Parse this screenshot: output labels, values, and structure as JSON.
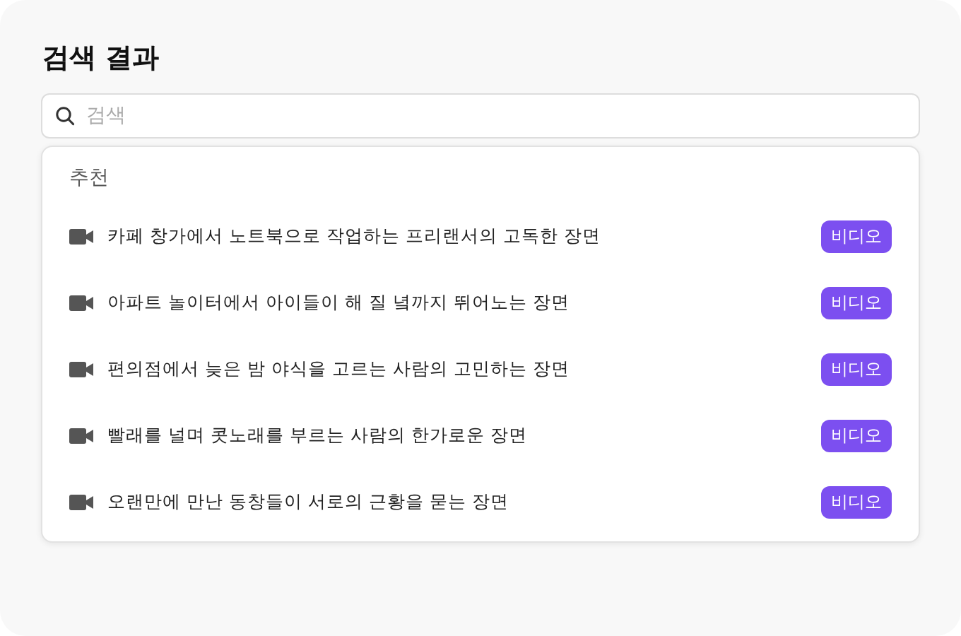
{
  "title": "검색 결과",
  "search": {
    "placeholder": "검색"
  },
  "section": "추천",
  "items": [
    {
      "kind": "video",
      "text": "카페 창가에서 노트북으로 작업하는 프리랜서의 고독한 장면",
      "badge": "비디오"
    },
    {
      "kind": "video",
      "text": "아파트 놀이터에서 아이들이 해 질 녘까지 뛰어노는 장면",
      "badge": "비디오"
    },
    {
      "kind": "video",
      "text": "편의점에서 늦은 밤 야식을 고르는 사람의 고민하는 장면",
      "badge": "비디오"
    },
    {
      "kind": "video",
      "text": "빨래를 널며 콧노래를 부르는 사람의 한가로운 장면",
      "badge": "비디오"
    },
    {
      "kind": "video",
      "text": "오랜만에 만난 동창들이 서로의 근황을 묻는 장면",
      "badge": "비디오"
    }
  ]
}
